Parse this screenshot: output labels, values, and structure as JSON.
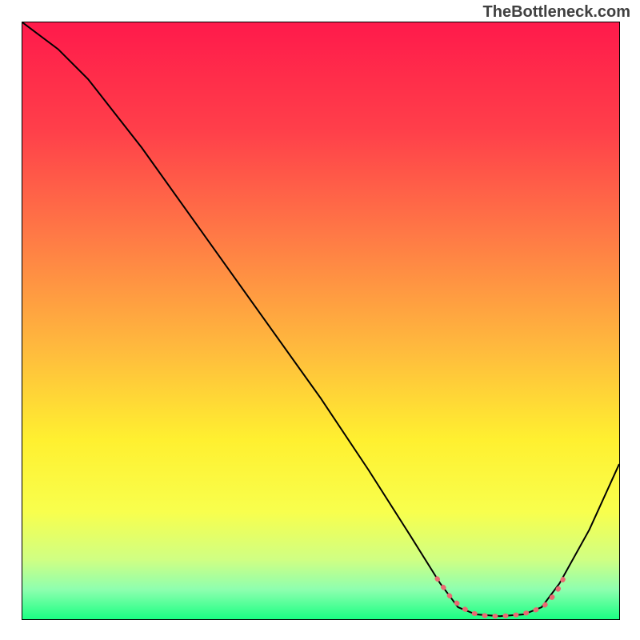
{
  "watermark": "TheBottleneck.com",
  "chart_data": {
    "type": "line",
    "title": "",
    "xlabel": "",
    "ylabel": "",
    "xlim": [
      0,
      100
    ],
    "ylim": [
      0,
      100
    ],
    "gradient_stops": [
      {
        "offset": 0,
        "color": "#ff1a4b"
      },
      {
        "offset": 18,
        "color": "#ff3f4a"
      },
      {
        "offset": 35,
        "color": "#ff7746"
      },
      {
        "offset": 55,
        "color": "#ffbb3d"
      },
      {
        "offset": 70,
        "color": "#fff030"
      },
      {
        "offset": 82,
        "color": "#f8ff4d"
      },
      {
        "offset": 90,
        "color": "#d0ff83"
      },
      {
        "offset": 95,
        "color": "#8effaf"
      },
      {
        "offset": 100,
        "color": "#1aff83"
      }
    ],
    "series": [
      {
        "name": "bottleneck-curve",
        "color": "#000000",
        "width": 2,
        "points": [
          {
            "x": 0,
            "y": 100
          },
          {
            "x": 6,
            "y": 95.5
          },
          {
            "x": 11,
            "y": 90.5
          },
          {
            "x": 20,
            "y": 79
          },
          {
            "x": 30,
            "y": 65
          },
          {
            "x": 40,
            "y": 51
          },
          {
            "x": 50,
            "y": 37
          },
          {
            "x": 58,
            "y": 25
          },
          {
            "x": 65,
            "y": 14
          },
          {
            "x": 70,
            "y": 6
          },
          {
            "x": 73,
            "y": 2
          },
          {
            "x": 76,
            "y": 0.8
          },
          {
            "x": 80,
            "y": 0.5
          },
          {
            "x": 84,
            "y": 0.8
          },
          {
            "x": 87,
            "y": 2
          },
          {
            "x": 90,
            "y": 6
          },
          {
            "x": 95,
            "y": 15
          },
          {
            "x": 100,
            "y": 26
          }
        ]
      },
      {
        "name": "optimal-range-marker",
        "color": "#e96a72",
        "width": 6,
        "dash": "1 12",
        "linecap": "round",
        "points": [
          {
            "x": 69.5,
            "y": 6.8
          },
          {
            "x": 71.5,
            "y": 4
          },
          {
            "x": 73.5,
            "y": 2
          },
          {
            "x": 75.5,
            "y": 1
          },
          {
            "x": 77.5,
            "y": 0.6
          },
          {
            "x": 79.5,
            "y": 0.5
          },
          {
            "x": 81.5,
            "y": 0.6
          },
          {
            "x": 83.5,
            "y": 0.8
          },
          {
            "x": 85.5,
            "y": 1.3
          },
          {
            "x": 87.5,
            "y": 2.3
          },
          {
            "x": 89.5,
            "y": 4.5
          },
          {
            "x": 91,
            "y": 7.5
          }
        ]
      }
    ]
  }
}
